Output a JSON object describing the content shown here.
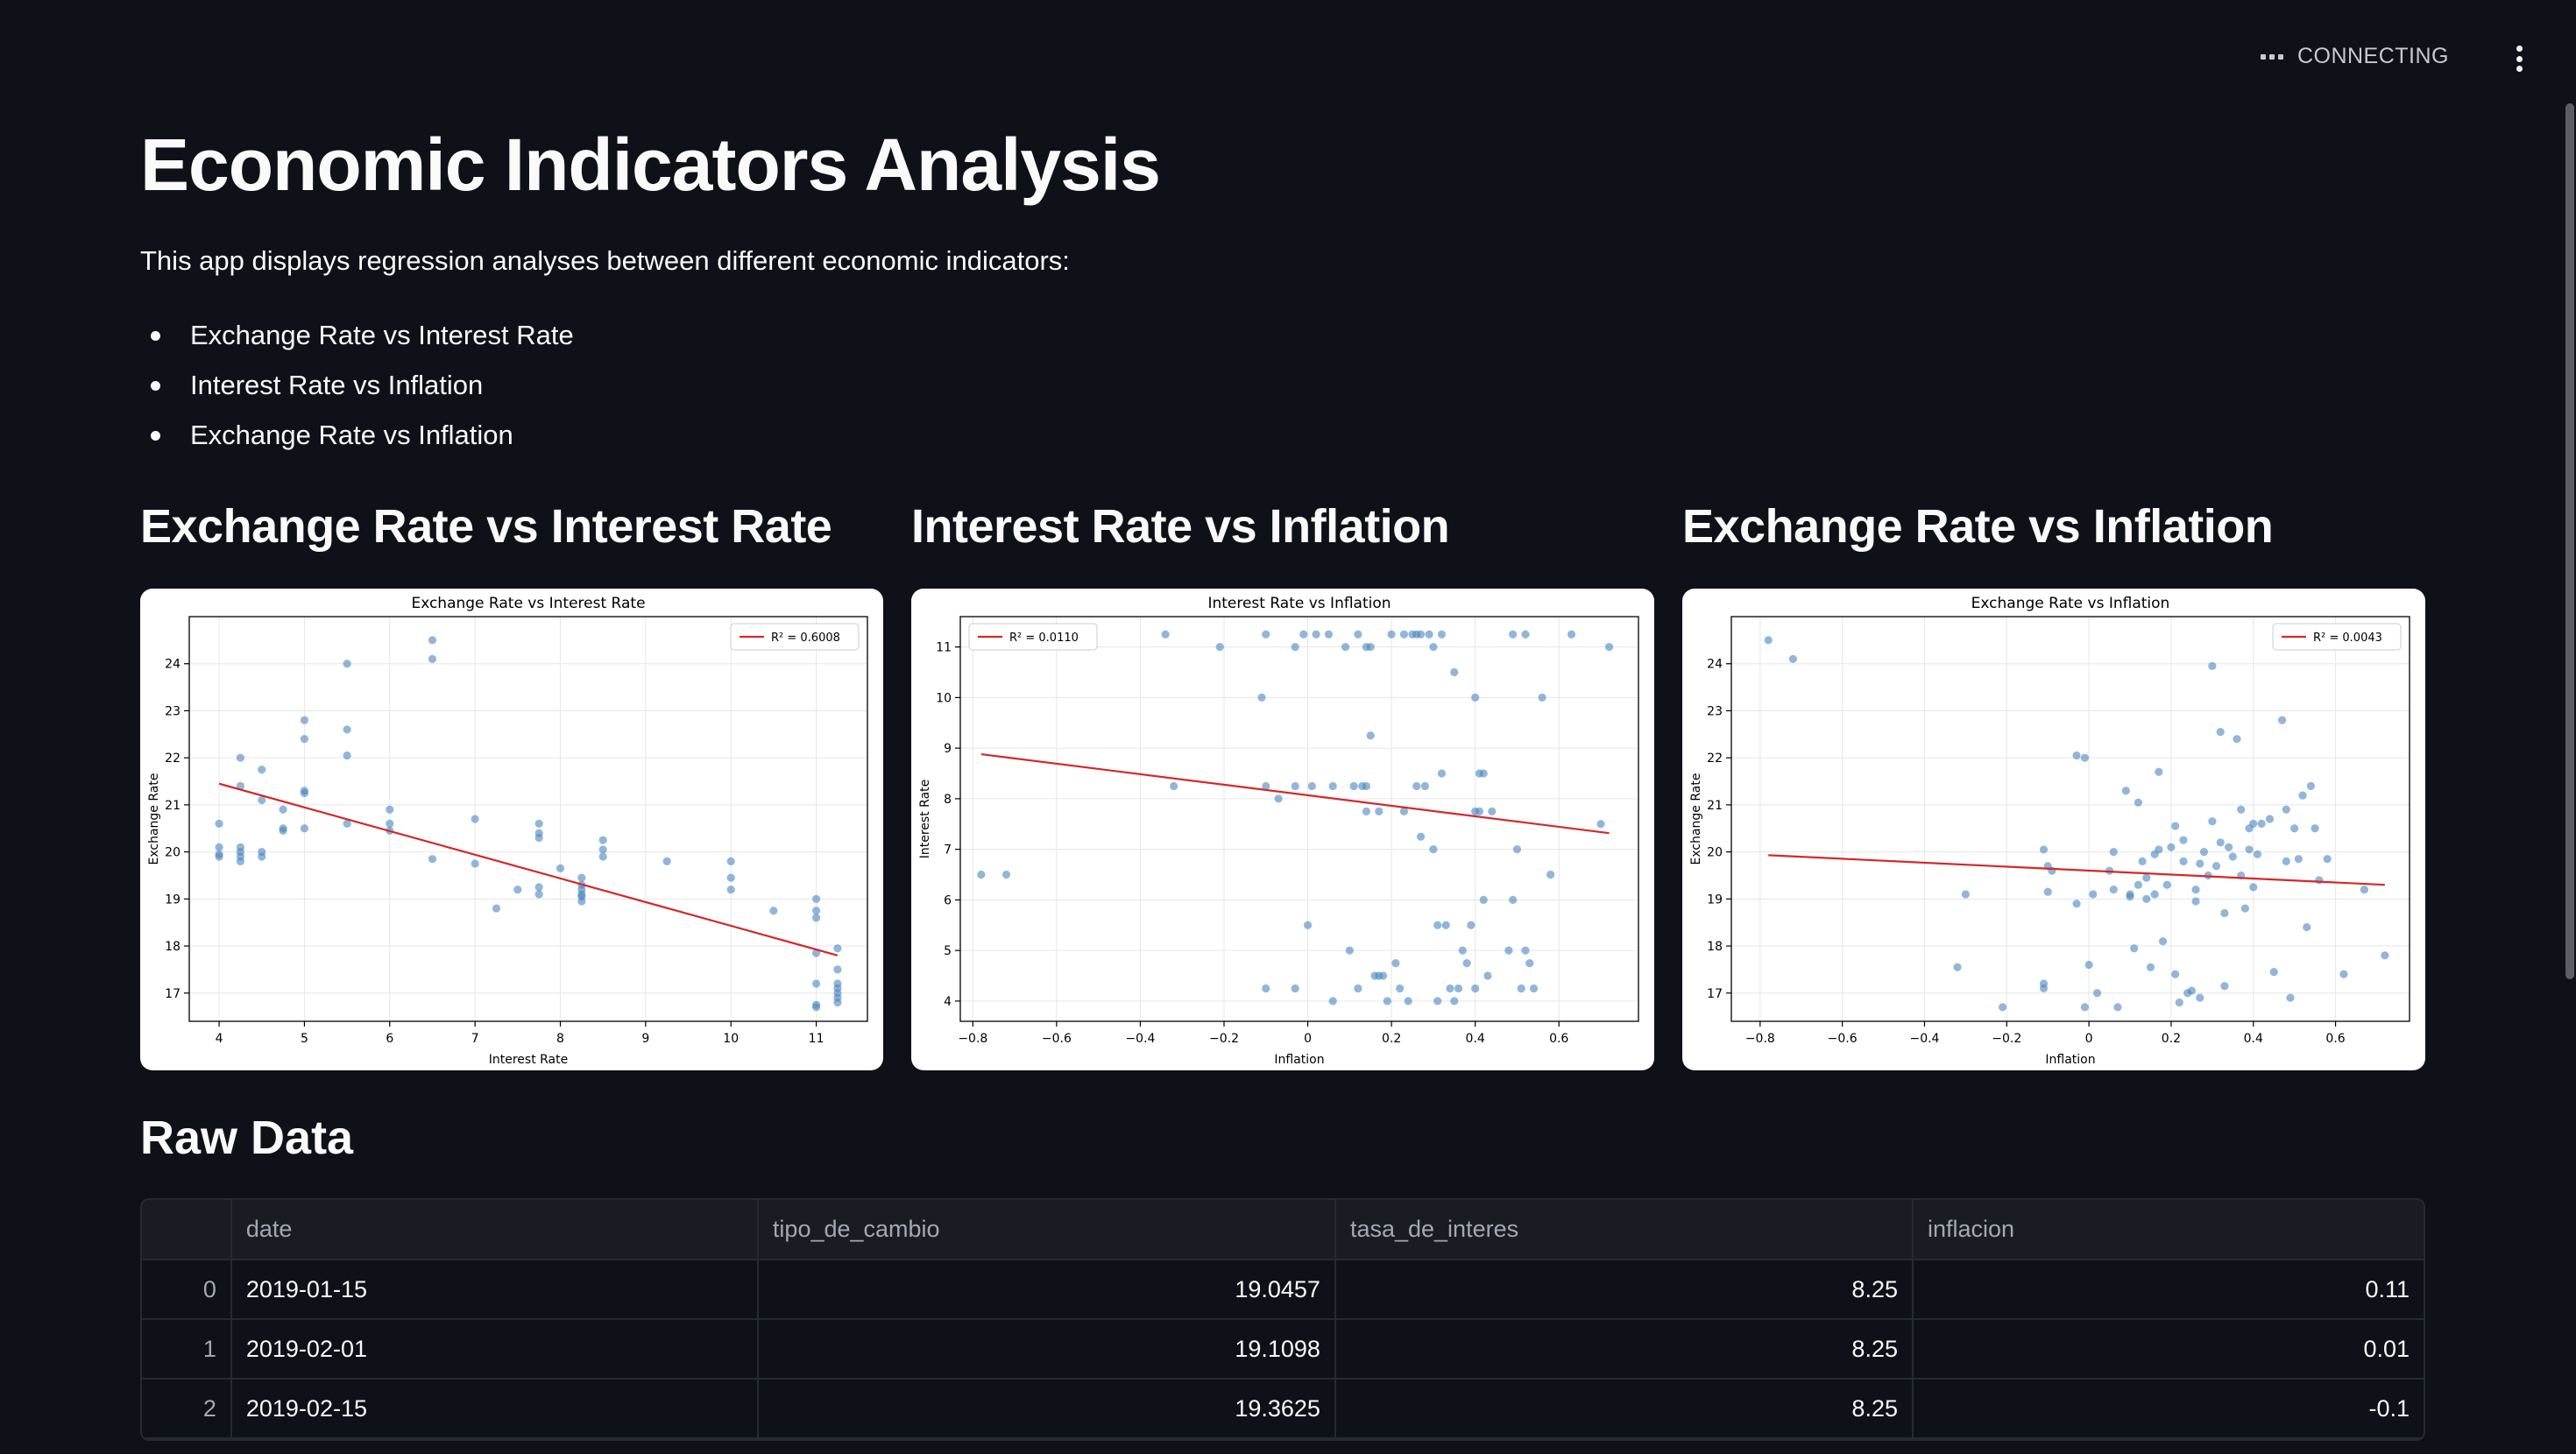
{
  "header": {
    "status_text": "CONNECTING"
  },
  "page": {
    "title": "Economic Indicators Analysis",
    "intro": "This app displays regression analyses between different economic indicators:",
    "bullets": [
      "Exchange Rate vs Interest Rate",
      "Interest Rate vs Inflation",
      "Exchange Rate vs Inflation"
    ]
  },
  "colors": {
    "background": "#0e1117",
    "point": "#4a85c0",
    "regression_line": "#d62728"
  },
  "chart_data": [
    {
      "type": "scatter",
      "heading": "Exchange Rate vs Interest Rate",
      "title": "Exchange Rate vs Interest Rate",
      "xlabel": "Interest Rate",
      "ylabel": "Exchange Rate",
      "xlim": [
        3.65,
        11.6
      ],
      "ylim": [
        16.4,
        25.0
      ],
      "xticks": [
        4,
        5,
        6,
        7,
        8,
        9,
        10,
        11
      ],
      "yticks": [
        17,
        18,
        19,
        20,
        21,
        22,
        23,
        24
      ],
      "grid": true,
      "legend": {
        "label": "R² = 0.6008",
        "position": "top-right"
      },
      "regression_line": [
        [
          4.0,
          21.45
        ],
        [
          11.25,
          17.8
        ]
      ],
      "points": [
        [
          4,
          20.6
        ],
        [
          4,
          20.1
        ],
        [
          4,
          19.95
        ],
        [
          4,
          19.9
        ],
        [
          4.25,
          22.0
        ],
        [
          4.25,
          21.4
        ],
        [
          4.25,
          20.1
        ],
        [
          4.25,
          20.0
        ],
        [
          4.25,
          19.9
        ],
        [
          4.25,
          19.8
        ],
        [
          4.5,
          21.75
        ],
        [
          4.5,
          21.1
        ],
        [
          4.5,
          20.0
        ],
        [
          4.5,
          19.9
        ],
        [
          4.75,
          20.9
        ],
        [
          4.75,
          20.5
        ],
        [
          4.75,
          20.45
        ],
        [
          5,
          22.8
        ],
        [
          5,
          22.4
        ],
        [
          5,
          21.3
        ],
        [
          5,
          21.25
        ],
        [
          5,
          20.5
        ],
        [
          5.5,
          24.0
        ],
        [
          5.5,
          22.6
        ],
        [
          5.5,
          22.05
        ],
        [
          5.5,
          20.6
        ],
        [
          6,
          20.9
        ],
        [
          6,
          20.6
        ],
        [
          6,
          20.45
        ],
        [
          6.5,
          24.5
        ],
        [
          6.5,
          24.1
        ],
        [
          6.5,
          19.85
        ],
        [
          7,
          20.7
        ],
        [
          7,
          19.75
        ],
        [
          7.25,
          18.8
        ],
        [
          7.5,
          19.2
        ],
        [
          7.75,
          20.6
        ],
        [
          7.75,
          20.4
        ],
        [
          7.75,
          20.3
        ],
        [
          7.75,
          19.25
        ],
        [
          7.75,
          19.1
        ],
        [
          8,
          19.65
        ],
        [
          8.25,
          19.45
        ],
        [
          8.25,
          19.3
        ],
        [
          8.25,
          19.2
        ],
        [
          8.25,
          19.1
        ],
        [
          8.25,
          19.05
        ],
        [
          8.25,
          18.95
        ],
        [
          8.5,
          20.25
        ],
        [
          8.5,
          20.05
        ],
        [
          8.5,
          19.9
        ],
        [
          9.25,
          19.8
        ],
        [
          10,
          19.8
        ],
        [
          10,
          19.45
        ],
        [
          10,
          19.2
        ],
        [
          10.5,
          18.75
        ],
        [
          11,
          19.0
        ],
        [
          11,
          18.75
        ],
        [
          11,
          18.6
        ],
        [
          11,
          17.85
        ],
        [
          11,
          17.2
        ],
        [
          11,
          16.75
        ],
        [
          11,
          16.7
        ],
        [
          11.25,
          17.95
        ],
        [
          11.25,
          17.5
        ],
        [
          11.25,
          17.2
        ],
        [
          11.25,
          17.1
        ],
        [
          11.25,
          17.0
        ],
        [
          11.25,
          16.9
        ],
        [
          11.25,
          16.8
        ]
      ]
    },
    {
      "type": "scatter",
      "heading": "Interest Rate vs Inflation",
      "title": "Interest Rate vs Inflation",
      "xlabel": "Inflation",
      "ylabel": "Interest Rate",
      "xlim": [
        -0.83,
        0.79
      ],
      "ylim": [
        3.6,
        11.6
      ],
      "xticks": [
        -0.8,
        -0.6,
        -0.4,
        -0.2,
        0.0,
        0.2,
        0.4,
        0.6
      ],
      "yticks": [
        4,
        5,
        6,
        7,
        8,
        9,
        10,
        11
      ],
      "grid": true,
      "legend": {
        "label": "R² = 0.0110",
        "position": "top-left"
      },
      "regression_line": [
        [
          -0.78,
          8.88
        ],
        [
          0.72,
          7.32
        ]
      ],
      "points": [
        [
          -0.78,
          6.5
        ],
        [
          -0.72,
          6.5
        ],
        [
          -0.32,
          8.25
        ],
        [
          -0.34,
          11.25
        ],
        [
          -0.21,
          11.0
        ],
        [
          -0.11,
          10.0
        ],
        [
          -0.1,
          11.25
        ],
        [
          -0.1,
          8.25
        ],
        [
          -0.1,
          4.25
        ],
        [
          -0.07,
          8.0
        ],
        [
          -0.03,
          11.0
        ],
        [
          -0.03,
          8.25
        ],
        [
          -0.03,
          4.25
        ],
        [
          -0.01,
          11.25
        ],
        [
          0.0,
          5.5
        ],
        [
          0.01,
          8.25
        ],
        [
          0.02,
          11.25
        ],
        [
          0.05,
          11.25
        ],
        [
          0.06,
          8.25
        ],
        [
          0.06,
          4.0
        ],
        [
          0.09,
          11.0
        ],
        [
          0.1,
          5.0
        ],
        [
          0.11,
          8.25
        ],
        [
          0.12,
          11.25
        ],
        [
          0.12,
          4.25
        ],
        [
          0.13,
          8.25
        ],
        [
          0.14,
          11.0
        ],
        [
          0.14,
          8.25
        ],
        [
          0.14,
          7.75
        ],
        [
          0.15,
          11.0
        ],
        [
          0.15,
          9.25
        ],
        [
          0.16,
          4.5
        ],
        [
          0.17,
          7.75
        ],
        [
          0.17,
          4.5
        ],
        [
          0.18,
          4.5
        ],
        [
          0.19,
          4.0
        ],
        [
          0.2,
          11.25
        ],
        [
          0.21,
          4.75
        ],
        [
          0.22,
          4.25
        ],
        [
          0.23,
          11.25
        ],
        [
          0.23,
          7.75
        ],
        [
          0.24,
          4.0
        ],
        [
          0.25,
          11.25
        ],
        [
          0.26,
          11.25
        ],
        [
          0.26,
          8.25
        ],
        [
          0.27,
          11.25
        ],
        [
          0.27,
          7.25
        ],
        [
          0.28,
          8.25
        ],
        [
          0.29,
          11.25
        ],
        [
          0.3,
          11.0
        ],
        [
          0.3,
          7.0
        ],
        [
          0.31,
          5.5
        ],
        [
          0.31,
          4.0
        ],
        [
          0.32,
          11.25
        ],
        [
          0.32,
          8.5
        ],
        [
          0.33,
          5.5
        ],
        [
          0.34,
          4.25
        ],
        [
          0.35,
          10.5
        ],
        [
          0.35,
          4.0
        ],
        [
          0.36,
          4.25
        ],
        [
          0.37,
          5.0
        ],
        [
          0.38,
          4.75
        ],
        [
          0.39,
          5.5
        ],
        [
          0.4,
          10.0
        ],
        [
          0.4,
          7.75
        ],
        [
          0.4,
          4.25
        ],
        [
          0.41,
          8.5
        ],
        [
          0.41,
          7.75
        ],
        [
          0.42,
          8.5
        ],
        [
          0.42,
          6.0
        ],
        [
          0.43,
          4.5
        ],
        [
          0.44,
          7.75
        ],
        [
          0.48,
          5.0
        ],
        [
          0.49,
          11.25
        ],
        [
          0.49,
          6.0
        ],
        [
          0.5,
          7.0
        ],
        [
          0.51,
          4.25
        ],
        [
          0.52,
          11.25
        ],
        [
          0.52,
          5.0
        ],
        [
          0.53,
          4.75
        ],
        [
          0.54,
          4.25
        ],
        [
          0.56,
          10.0
        ],
        [
          0.58,
          6.5
        ],
        [
          0.63,
          11.25
        ],
        [
          0.7,
          7.5
        ],
        [
          0.72,
          11.0
        ]
      ]
    },
    {
      "type": "scatter",
      "heading": "Exchange Rate vs Inflation",
      "title": "Exchange Rate vs Inflation",
      "xlabel": "Inflation",
      "ylabel": "Exchange Rate",
      "xlim": [
        -0.87,
        0.78
      ],
      "ylim": [
        16.4,
        25.0
      ],
      "xticks": [
        -0.8,
        -0.6,
        -0.4,
        -0.2,
        0.0,
        0.2,
        0.4,
        0.6
      ],
      "yticks": [
        17,
        18,
        19,
        20,
        21,
        22,
        23,
        24
      ],
      "grid": true,
      "legend": {
        "label": "R² = 0.0043",
        "position": "top-right"
      },
      "regression_line": [
        [
          -0.78,
          19.93
        ],
        [
          0.72,
          19.3
        ]
      ],
      "points": [
        [
          -0.78,
          24.5
        ],
        [
          -0.72,
          24.1
        ],
        [
          -0.32,
          17.55
        ],
        [
          -0.3,
          19.1
        ],
        [
          -0.21,
          16.7
        ],
        [
          -0.11,
          20.05
        ],
        [
          -0.11,
          17.2
        ],
        [
          -0.11,
          17.1
        ],
        [
          -0.1,
          19.7
        ],
        [
          -0.1,
          19.15
        ],
        [
          -0.09,
          19.6
        ],
        [
          -0.03,
          22.05
        ],
        [
          -0.03,
          18.9
        ],
        [
          -0.01,
          22.0
        ],
        [
          -0.01,
          16.7
        ],
        [
          0.0,
          17.6
        ],
        [
          0.01,
          19.1
        ],
        [
          0.02,
          17.0
        ],
        [
          0.05,
          19.6
        ],
        [
          0.06,
          20.0
        ],
        [
          0.06,
          19.2
        ],
        [
          0.07,
          16.7
        ],
        [
          0.09,
          21.3
        ],
        [
          0.1,
          19.1
        ],
        [
          0.1,
          19.05
        ],
        [
          0.11,
          17.95
        ],
        [
          0.12,
          21.05
        ],
        [
          0.12,
          19.3
        ],
        [
          0.13,
          19.8
        ],
        [
          0.14,
          19.45
        ],
        [
          0.14,
          19.0
        ],
        [
          0.15,
          17.55
        ],
        [
          0.16,
          19.95
        ],
        [
          0.16,
          19.1
        ],
        [
          0.17,
          20.05
        ],
        [
          0.17,
          21.7
        ],
        [
          0.18,
          18.1
        ],
        [
          0.19,
          19.3
        ],
        [
          0.2,
          20.1
        ],
        [
          0.21,
          20.55
        ],
        [
          0.21,
          17.4
        ],
        [
          0.22,
          16.8
        ],
        [
          0.23,
          19.8
        ],
        [
          0.23,
          20.25
        ],
        [
          0.24,
          17.0
        ],
        [
          0.25,
          17.05
        ],
        [
          0.26,
          19.2
        ],
        [
          0.26,
          18.95
        ],
        [
          0.27,
          19.75
        ],
        [
          0.27,
          16.9
        ],
        [
          0.28,
          20.0
        ],
        [
          0.29,
          19.5
        ],
        [
          0.3,
          20.65
        ],
        [
          0.3,
          23.95
        ],
        [
          0.31,
          19.7
        ],
        [
          0.32,
          22.55
        ],
        [
          0.32,
          20.2
        ],
        [
          0.33,
          18.7
        ],
        [
          0.33,
          17.15
        ],
        [
          0.34,
          20.1
        ],
        [
          0.35,
          19.9
        ],
        [
          0.36,
          22.4
        ],
        [
          0.37,
          20.9
        ],
        [
          0.37,
          19.5
        ],
        [
          0.38,
          18.8
        ],
        [
          0.39,
          20.5
        ],
        [
          0.39,
          20.05
        ],
        [
          0.4,
          20.6
        ],
        [
          0.4,
          19.25
        ],
        [
          0.41,
          19.95
        ],
        [
          0.42,
          20.6
        ],
        [
          0.44,
          20.7
        ],
        [
          0.45,
          17.45
        ],
        [
          0.47,
          22.8
        ],
        [
          0.48,
          20.9
        ],
        [
          0.48,
          19.8
        ],
        [
          0.49,
          16.9
        ],
        [
          0.5,
          20.5
        ],
        [
          0.51,
          19.85
        ],
        [
          0.52,
          21.2
        ],
        [
          0.53,
          18.4
        ],
        [
          0.54,
          21.4
        ],
        [
          0.55,
          20.5
        ],
        [
          0.56,
          19.4
        ],
        [
          0.58,
          19.85
        ],
        [
          0.62,
          17.4
        ],
        [
          0.67,
          19.2
        ],
        [
          0.72,
          17.8
        ]
      ]
    }
  ],
  "raw_data": {
    "heading": "Raw Data",
    "columns": [
      "date",
      "tipo_de_cambio",
      "tasa_de_interes",
      "inflacion"
    ],
    "rows": [
      {
        "index": "0",
        "date": "2019-01-15",
        "tipo_de_cambio": "19.0457",
        "tasa_de_interes": "8.25",
        "inflacion": "0.11"
      },
      {
        "index": "1",
        "date": "2019-02-01",
        "tipo_de_cambio": "19.1098",
        "tasa_de_interes": "8.25",
        "inflacion": "0.01"
      },
      {
        "index": "2",
        "date": "2019-02-15",
        "tipo_de_cambio": "19.3625",
        "tasa_de_interes": "8.25",
        "inflacion": "-0.1"
      }
    ]
  }
}
